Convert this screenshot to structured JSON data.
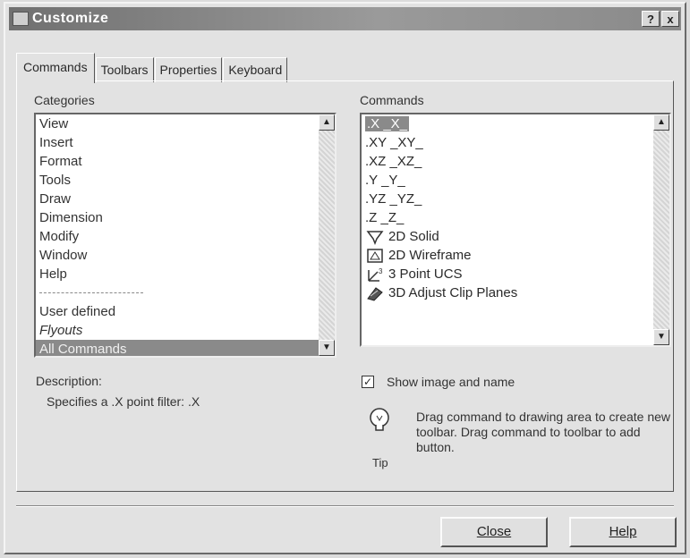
{
  "window": {
    "title": "Customize",
    "help_btn": "?",
    "close_btn": "x"
  },
  "tabs": [
    {
      "label": "Commands"
    },
    {
      "label": "Toolbars"
    },
    {
      "label": "Properties"
    },
    {
      "label": "Keyboard"
    }
  ],
  "categories": {
    "label": "Categories",
    "items": [
      "View",
      "Insert",
      "Format",
      "Tools",
      "Draw",
      "Dimension",
      "Modify",
      "Window",
      "Help"
    ],
    "after_sep": [
      "User defined",
      "Flyouts"
    ],
    "selected": "All Commands"
  },
  "commands": {
    "label": "Commands",
    "items": [
      {
        "text": ".X _X_",
        "icon": "dot-x-icon"
      },
      {
        "text": ".XY _XY_",
        "icon": "dot-xy-icon"
      },
      {
        "text": ".XZ _XZ_",
        "icon": "dot-xz-icon"
      },
      {
        "text": ".Y _Y_",
        "icon": "dot-y-icon"
      },
      {
        "text": ".YZ _YZ_",
        "icon": "dot-yz-icon"
      },
      {
        "text": ".Z _Z_",
        "icon": "dot-z-icon"
      },
      {
        "text": "2D Solid",
        "icon": "2d-solid-icon"
      },
      {
        "text": "2D Wireframe",
        "icon": "2d-wireframe-icon"
      },
      {
        "text": "3 Point UCS",
        "icon": "3-point-ucs-icon"
      },
      {
        "text": "3D Adjust Clip Planes",
        "icon": "3d-adjust-clip-planes-icon"
      }
    ]
  },
  "description": {
    "label": "Description:",
    "text": "Specifies a .X point filter:  .X"
  },
  "show_image": {
    "label": "Show image and name",
    "checked": true
  },
  "tip": {
    "caption": "Tip",
    "text": "Drag command to drawing area to create new toolbar. Drag command to toolbar to add button."
  },
  "buttons": {
    "close": "Close",
    "help": "Help"
  }
}
